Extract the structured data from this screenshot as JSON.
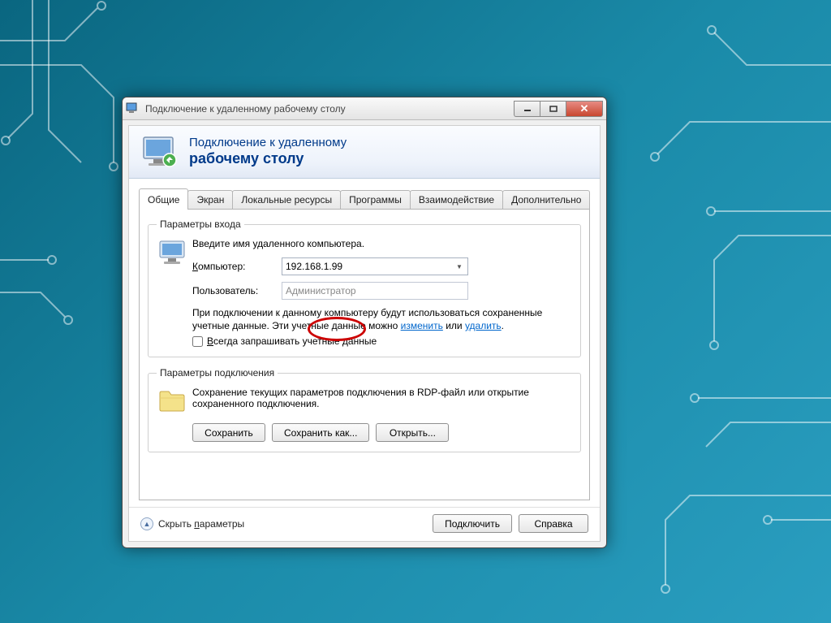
{
  "window": {
    "title": "Подключение к удаленному рабочему столу",
    "banner_line1": "Подключение к удаленному",
    "banner_line2": "рабочему столу"
  },
  "tabs": {
    "general": "Общие",
    "display": "Экран",
    "local": "Локальные ресурсы",
    "programs": "Программы",
    "experience": "Взаимодействие",
    "advanced": "Дополнительно"
  },
  "login_group": {
    "legend": "Параметры входа",
    "instruction": "Введите имя удаленного компьютера.",
    "computer_label_pre": "К",
    "computer_label_post": "омпьютер:",
    "computer_value": "192.168.1.99",
    "user_label": "Пользователь:",
    "user_placeholder": "Администратор",
    "cred_text1": "При подключении к данному компьютеру будут использоваться сохраненные учетные данные. Эти учетные данные можно ",
    "link_change": "изменить",
    "cred_or": " или ",
    "link_delete": "удалить",
    "cred_end": ".",
    "always_ask_pre": "В",
    "always_ask_post": "сегда запрашивать учетные данные"
  },
  "conn_group": {
    "legend": "Параметры подключения",
    "text": "Сохранение текущих параметров подключения в RDP-файл или открытие сохраненного подключения.",
    "save": "Сохранить",
    "save_as": "Сохранить как...",
    "open": "Открыть..."
  },
  "footer": {
    "hide_pre": "Скрыть ",
    "hide_u": "п",
    "hide_post": "араметры",
    "connect": "Подключить",
    "help": "Справка"
  }
}
